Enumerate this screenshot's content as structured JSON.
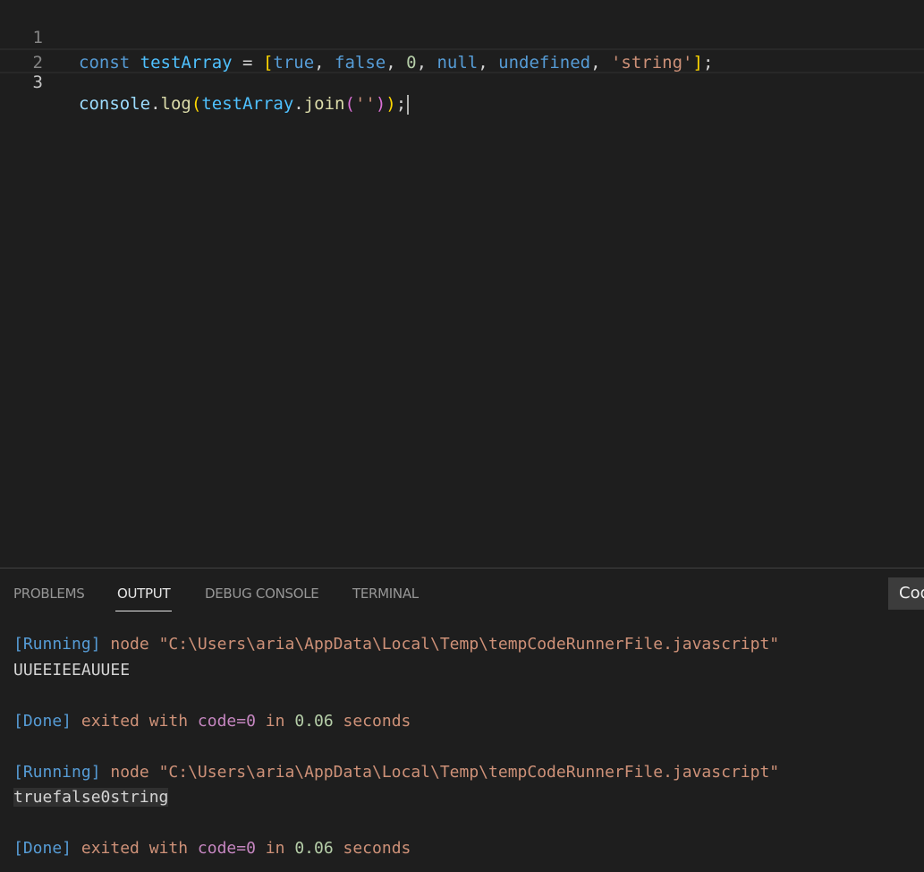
{
  "editor": {
    "lines": [
      {
        "number": "1"
      },
      {
        "number": "2"
      },
      {
        "number": "3"
      }
    ],
    "line1": {
      "const": "const",
      "name": "testArray",
      "eq": " = ",
      "open": "[",
      "v_true": "true",
      "v_false": "false",
      "v_zero": "0",
      "v_null": "null",
      "v_undefined": "undefined",
      "v_string": "'string'",
      "close": "]",
      "semi": ";",
      "sep": ", "
    },
    "line3": {
      "console": "console",
      "dot1": ".",
      "log": "log",
      "paren_open": "(",
      "arg": "testArray",
      "dot2": ".",
      "join": "join",
      "inner_open": "(",
      "arg2": "''",
      "inner_close": ")",
      "paren_close": ")",
      "semi": ";"
    }
  },
  "panel": {
    "tabs": [
      {
        "label": "PROBLEMS"
      },
      {
        "label": "OUTPUT"
      },
      {
        "label": "DEBUG CONSOLE"
      },
      {
        "label": "TERMINAL"
      }
    ],
    "active_tab": "OUTPUT",
    "channel_select": "Code"
  },
  "output": {
    "run1": {
      "tag": "[Running]",
      "cmd": " node \"C:\\Users\\aria\\AppData\\Local\\Temp\\tempCodeRunnerFile.javascript\""
    },
    "result1": "UUEEIEEAUUEE",
    "done1": {
      "tag": "[Done]",
      "exited": " exited with ",
      "code": "code=0",
      "in": " in ",
      "secs": "0.06",
      "seconds": " seconds"
    },
    "run2": {
      "tag": "[Running]",
      "cmd": " node \"C:\\Users\\aria\\AppData\\Local\\Temp\\tempCodeRunnerFile.javascript\""
    },
    "result2": "truefalse0string",
    "done2": {
      "tag": "[Done]",
      "exited": " exited with ",
      "code": "code=0",
      "in": " in ",
      "secs": "0.06",
      "seconds": " seconds"
    }
  },
  "colors": {
    "background": "#1e1e1e",
    "keyword": "#569cd6",
    "string": "#ce9178",
    "number": "#b5cea8",
    "function": "#dcdcaa",
    "variable": "#4fc1ff"
  }
}
